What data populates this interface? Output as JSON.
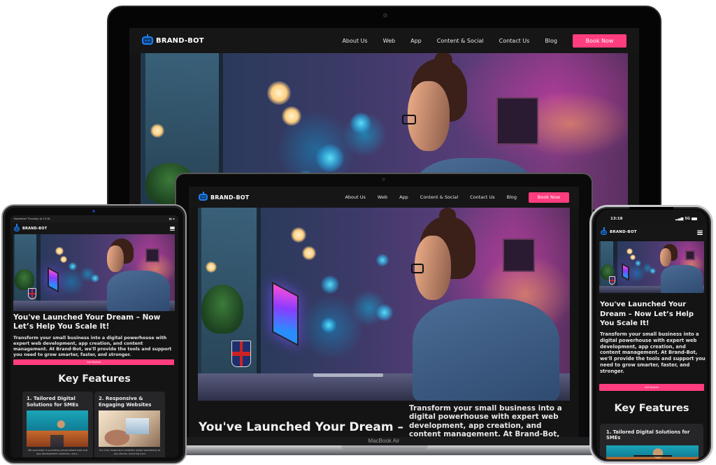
{
  "brand": {
    "name": "BRAND-BOT",
    "accent_color": "#ff3d7f",
    "logo_color": "#1e7ff0",
    "background_color": "#141414"
  },
  "nav": {
    "items": [
      {
        "label": "About Us"
      },
      {
        "label": "Web"
      },
      {
        "label": "App"
      },
      {
        "label": "Content & Social"
      },
      {
        "label": "Contact Us"
      },
      {
        "label": "Blog"
      }
    ],
    "book_label": "Book Now",
    "menu_icon": "hamburger-menu-icon"
  },
  "hero": {
    "image_alt": "Man with glasses working on a laptop in a neon-lit room with a Union Jack mug",
    "title": "You've Launched Your Dream – Now Let’s Help You Scale It!",
    "title_truncated": "You've Launched Your Dream –",
    "text": "Transform your small business into a digital powerhouse with expert web development, app creation, and content management. At Brand-Bot, we'll provide the tools and support you need to grow smarter, faster, and stronger.",
    "text_truncated": "Transform your small business into a digital powerhouse with expert web development, app creation, and content management. At Brand-Bot, we'll provide the tools and",
    "cta_label": "Get Started"
  },
  "features": {
    "title": "Key Features",
    "cards": [
      {
        "title": "1. Tailored Digital Solutions for SMEs",
        "text": "We specialise in providing personalised web and app development solutions, uniq..."
      },
      {
        "title": "2. Responsive & Engaging Websites",
        "text": "Our fully responsive websites adapt seamlessly to any device, ensuring your"
      }
    ]
  },
  "devices": {
    "laptop_label": "MacBook Air",
    "ipad_status": "November Thursday at 13:18",
    "phone_time": "13:18",
    "phone_network": "5G"
  }
}
